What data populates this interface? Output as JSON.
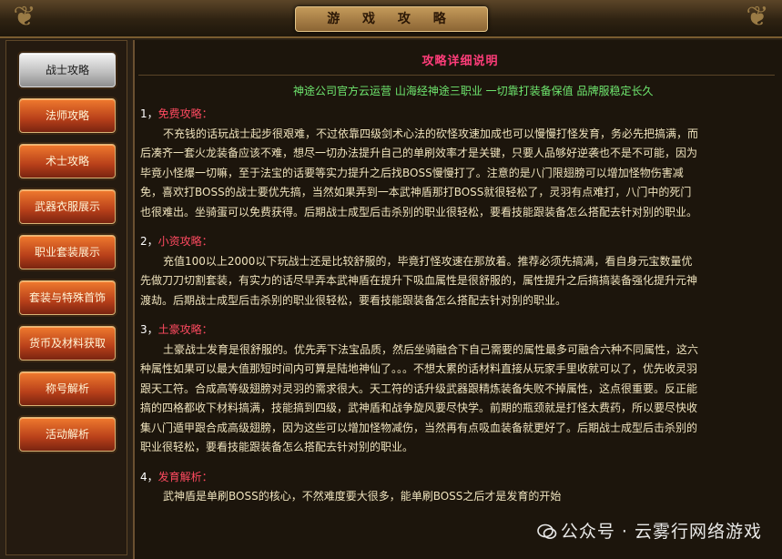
{
  "header": {
    "title": "游 戏 攻 略"
  },
  "sidebar": {
    "items": [
      {
        "label": "战士攻略",
        "active": true
      },
      {
        "label": "法师攻略",
        "active": false
      },
      {
        "label": "术士攻略",
        "active": false
      },
      {
        "label": "武器衣服展示",
        "active": false
      },
      {
        "label": "职业套装展示",
        "active": false
      },
      {
        "label": "套装与特殊首饰",
        "active": false
      },
      {
        "label": "货币及材料获取",
        "active": false
      },
      {
        "label": "称号解析",
        "active": false
      },
      {
        "label": "活动解析",
        "active": false
      }
    ]
  },
  "main": {
    "section_title": "攻略详细说明",
    "banner": "神途公司官方云运营 山海经神途三职业 一切靠打装备保值 品牌服稳定长久",
    "sections": [
      {
        "num": "1，",
        "label": "免费攻略：",
        "text": "不充钱的话玩战士起步很艰难，不过依靠四级剑术心法的砍怪攻速加成也可以慢慢打怪发育，务必先把搞满，而后凑齐一套火龙装备应该不难，想尽一切办法提升自己的单刷效率才是关键，只要人品够好逆袭也不是不可能，因为毕竟小怪爆一切嘛，至于法宝的话要等实力提升之后找BOSS慢慢打了。注意的是八门限翅膀可以增加怪物伤害减免，喜欢打BOSS的战士要优先搞，当然如果弄到一本武神盾那打BOSS就很轻松了，灵羽有点难打，八门中的死门也很难出。坐骑蛋可以免费获得。后期战士成型后击杀别的职业很轻松，要看技能跟装备怎么搭配去针对别的职业。"
      },
      {
        "num": "2，",
        "label": "小资攻略：",
        "text": "充值100以上2000以下玩战士还是比较舒服的，毕竟打怪攻速在那放着。推荐必须先搞满，看自身元宝数量优先做刀刀切割套装，有实力的话尽早弄本武神盾在提升下吸血属性是很舒服的，属性提升之后搞搞装备强化提升元神渡劫。后期战士成型后击杀别的职业很轻松，要看技能跟装备怎么搭配去针对别的职业。"
      },
      {
        "num": "3，",
        "label": "土豪攻略：",
        "text": "土豪战士发育是很舒服的。优先弄下法宝品质，然后坐骑融合下自己需要的属性最多可融合六种不同属性，这六种属性如果可以最大值那短时间内可算是陆地神仙了。。。不想太累的话材料直接从玩家手里收就可以了，优先收灵羽跟天工符。合成高等级翅膀对灵羽的需求很大。天工符的话升级武器跟精炼装备失败不掉属性，这点很重要。反正能搞的四格都收下材料搞满，技能搞到四级，武神盾和战争旋风要尽快学。前期的瓶颈就是打怪太费药，所以要尽快收集八门遁甲跟合成高级翅膀，因为这些可以增加怪物减伤，当然再有点吸血装备就更好了。后期战士成型后击杀别的职业很轻松，要看技能跟装备怎么搭配去针对别的职业。"
      },
      {
        "num": "4，",
        "label": "发育解析：",
        "text": "武神盾是单刷BOSS的核心，不然难度要大很多，能单刷BOSS之后才是发育的开始"
      }
    ]
  },
  "watermark": {
    "text": "公众号 · 云雾行网络游戏"
  }
}
